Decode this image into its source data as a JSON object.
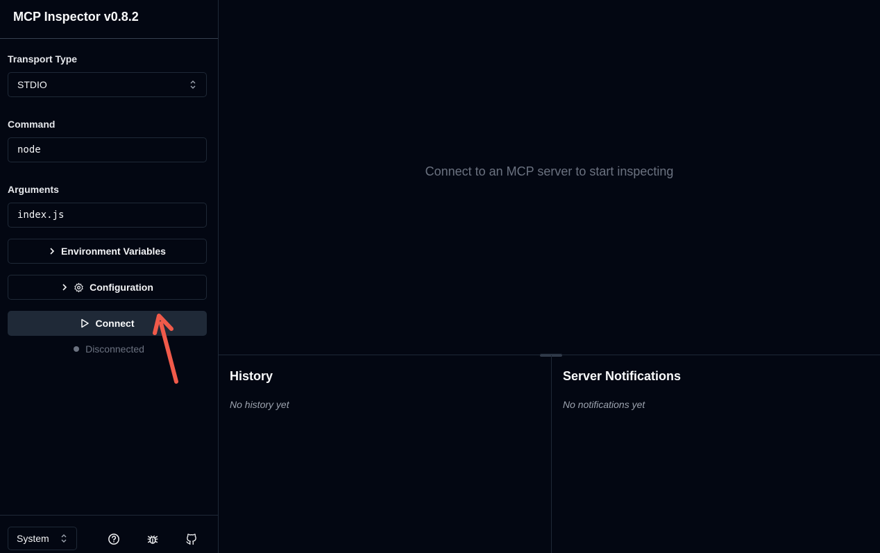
{
  "app": {
    "title": "MCP Inspector v0.8.2"
  },
  "sidebar": {
    "transport": {
      "label": "Transport Type",
      "value": "STDIO",
      "icon": "chevrons-up-down-icon"
    },
    "command": {
      "label": "Command",
      "value": "node"
    },
    "arguments": {
      "label": "Arguments",
      "value": "index.js"
    },
    "env_button": {
      "label": "Environment Variables",
      "icon": "chevron-right-icon"
    },
    "config_button": {
      "label": "Configuration",
      "icon": "gear-icon"
    },
    "connect_button": {
      "label": "Connect",
      "icon": "play-icon"
    },
    "status": {
      "text": "Disconnected",
      "color": "#6b7280"
    },
    "footer": {
      "theme": {
        "value": "System"
      },
      "icons": [
        "help-circle-icon",
        "bug-icon",
        "github-icon"
      ]
    }
  },
  "main": {
    "empty_message": "Connect to an MCP server to start inspecting",
    "history": {
      "title": "History",
      "empty": "No history yet"
    },
    "notifications": {
      "title": "Server Notifications",
      "empty": "No notifications yet"
    }
  },
  "colors": {
    "background": "#030712",
    "border": "#1f2937",
    "annotation_arrow": "#f05a4a"
  }
}
